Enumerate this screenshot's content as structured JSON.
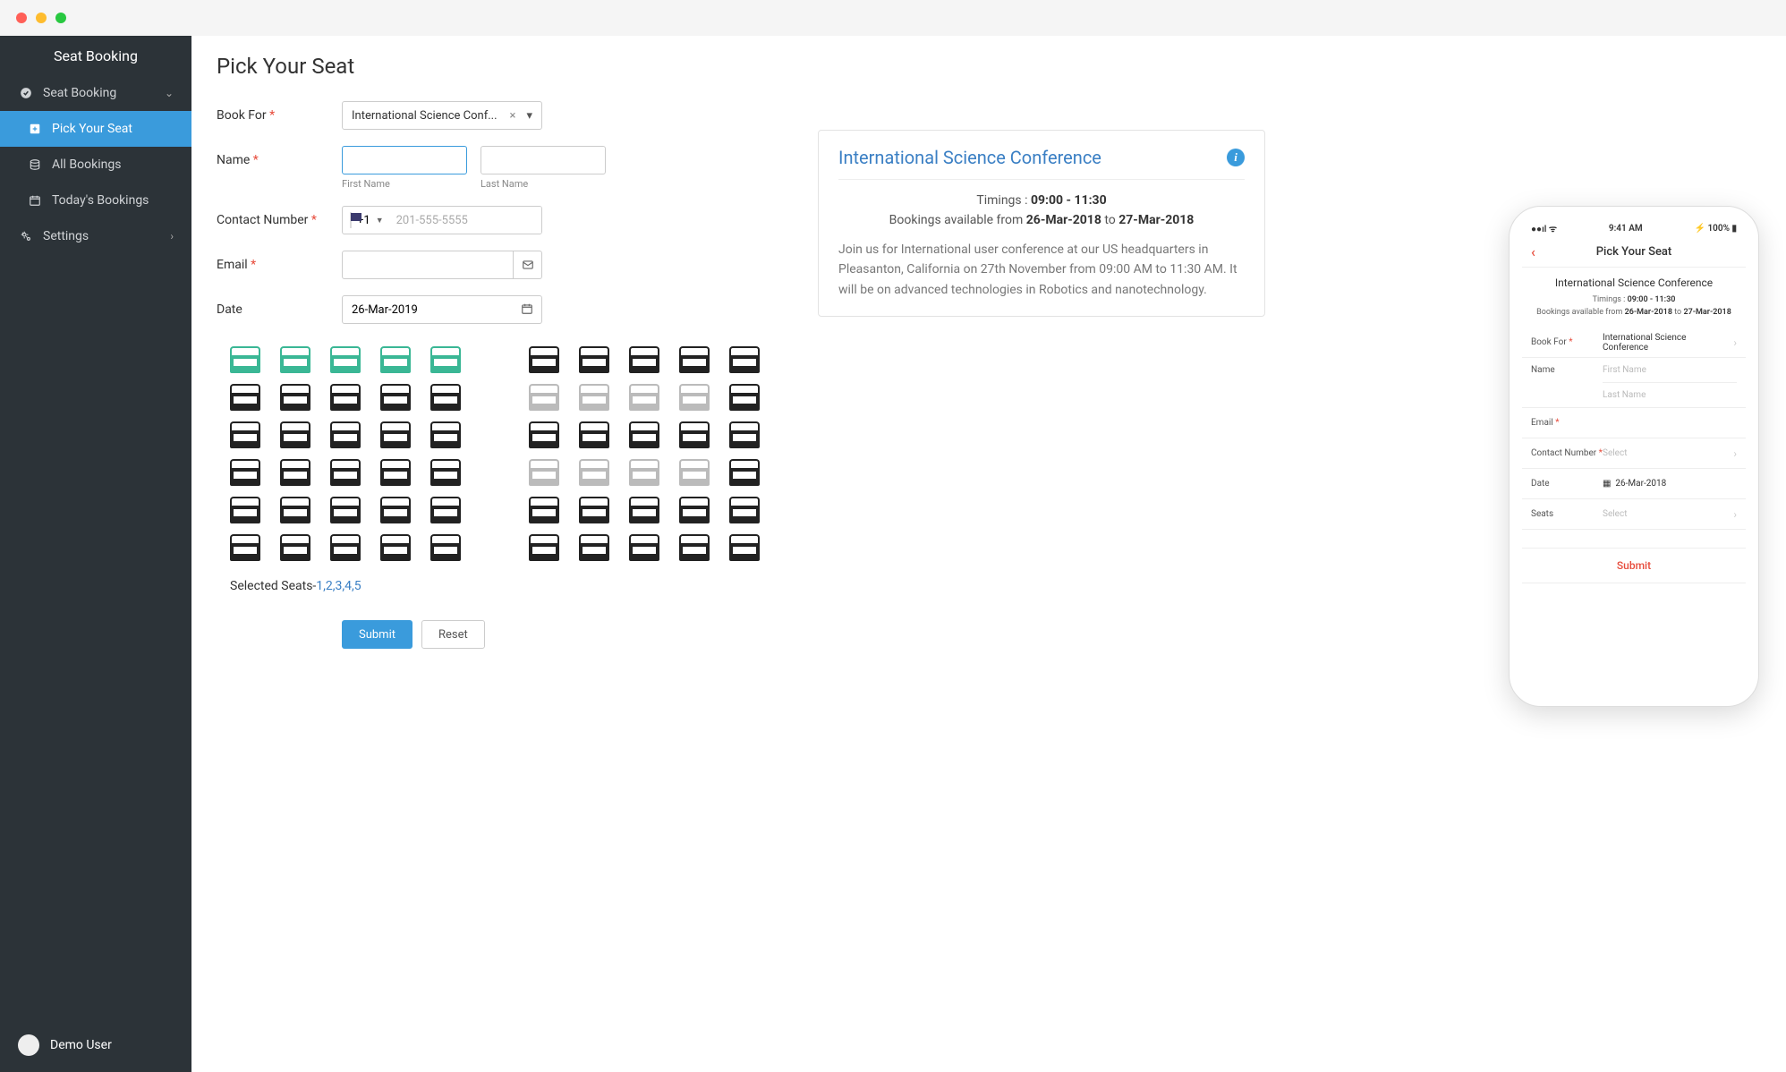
{
  "app": {
    "title": "Seat Booking"
  },
  "sidebar": {
    "items": [
      {
        "label": "Seat Booking",
        "icon": "check-circle-icon",
        "expandable": true
      },
      {
        "label": "Pick Your Seat",
        "icon": "plus-square-icon",
        "active": true
      },
      {
        "label": "All Bookings",
        "icon": "stack-icon"
      },
      {
        "label": "Today's Bookings",
        "icon": "calendar-icon"
      },
      {
        "label": "Settings",
        "icon": "gears-icon",
        "expandable": true
      }
    ],
    "user": "Demo User"
  },
  "page": {
    "title": "Pick Your Seat"
  },
  "form": {
    "book_for": {
      "label": "Book For",
      "value": "International Science Conf..."
    },
    "name": {
      "label": "Name",
      "first_sub": "First Name",
      "last_sub": "Last Name"
    },
    "contact": {
      "label": "Contact Number",
      "cc": "+1",
      "placeholder": "201-555-5555"
    },
    "email": {
      "label": "Email"
    },
    "date": {
      "label": "Date",
      "value": "26-Mar-2019"
    },
    "submit": "Submit",
    "reset": "Reset"
  },
  "info": {
    "title": "International Science Conference",
    "timings_label": "Timings : ",
    "timings": "09:00 - 11:30",
    "bookings_prefix": "Bookings available from ",
    "from_date": "26-Mar-2018",
    "to_word": " to ",
    "to_date": "27-Mar-2018",
    "desc": "Join us for International user conference at our US headquarters in Pleasanton, California on 27th November from 09:00 AM to 11:30 AM. It will be on advanced technologies in Robotics and nanotechnology."
  },
  "seats": {
    "selected_label": "Selected Seats-",
    "selected_values": "1,2,3,4,5",
    "left_block_rows": 6,
    "right_block_rows": 6,
    "cols": 5,
    "selected_indices": [
      0,
      1,
      2,
      3,
      4
    ],
    "disabled_right_indices": [
      5,
      6,
      7,
      8,
      15,
      16,
      17,
      18
    ]
  },
  "mobile": {
    "time": "9:41 AM",
    "battery": "100%",
    "nav_title": "Pick Your Seat",
    "header_title": "International Science Conference",
    "timings_label": "Timings  : ",
    "timings": "09:00 - 11:30",
    "bookings_prefix": "Bookings available from ",
    "from_date": "26-Mar-2018",
    "to_word": " to ",
    "to_date": "27-Mar-2018",
    "rows": {
      "book_for": {
        "label": "Book For",
        "value": "International Science Conference"
      },
      "name": {
        "label": "Name",
        "first_ph": "First Name",
        "last_ph": "Last Name"
      },
      "email": {
        "label": "Email"
      },
      "contact": {
        "label": "Contact Number",
        "value": "Select"
      },
      "date": {
        "label": "Date",
        "value": "26-Mar-2018"
      },
      "seats": {
        "label": "Seats",
        "value": "Select"
      }
    },
    "submit": "Submit"
  }
}
